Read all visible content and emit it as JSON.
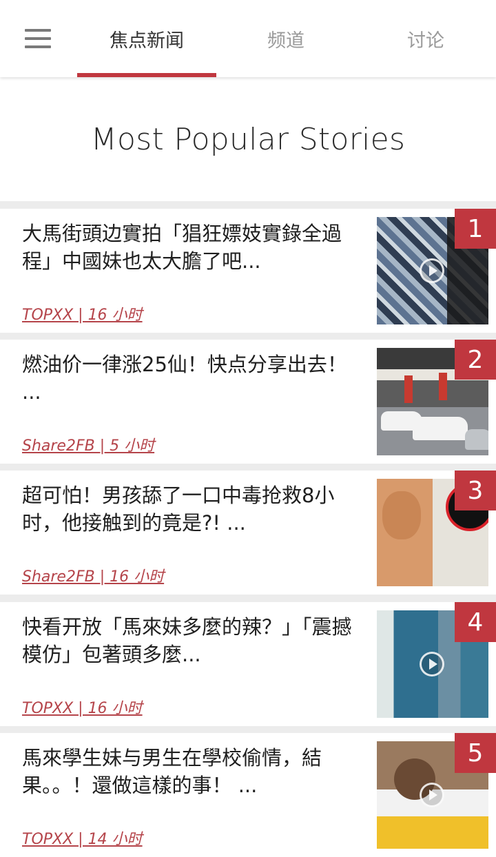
{
  "nav": {
    "tabs": [
      {
        "label": "焦点新闻",
        "active": true
      },
      {
        "label": "频道",
        "active": false
      },
      {
        "label": "讨论",
        "active": false
      }
    ],
    "accent_color": "#c0373f"
  },
  "page": {
    "heading": "Most Popular Stories"
  },
  "stories": [
    {
      "rank": "1",
      "title": "大馬街頭边實拍「猖狂嫖妓實錄全過程」中國妹也太大膽了吧...",
      "source": "TOPXX",
      "time": "16 小时",
      "meta": "TOPXX | 16 小时",
      "has_video": true
    },
    {
      "rank": "2",
      "title": "燃油价一律涨25仙！快点分享出去！ ...",
      "source": "Share2FB",
      "time": "5 小时",
      "meta": "Share2FB | 5 小时",
      "has_video": false
    },
    {
      "rank": "3",
      "title": "超可怕！男孩舔了一口中毒抢救8小时，他接触到的竟是?! ...",
      "source": "Share2FB",
      "time": "16 小时",
      "meta": "Share2FB | 16 小时",
      "has_video": false
    },
    {
      "rank": "4",
      "title": "快看开放「馬來妹多麼的辣？」「震撼模仿」包著頭多麼...",
      "source": "TOPXX",
      "time": "16 小时",
      "meta": "TOPXX | 16 小时",
      "has_video": true
    },
    {
      "rank": "5",
      "title": "馬來學生妹与男生在學校偷情，結果。。！還做這樣的事！ ...",
      "source": "TOPXX",
      "time": "14 小时",
      "meta": "TOPXX | 14 小时",
      "has_video": true
    }
  ]
}
